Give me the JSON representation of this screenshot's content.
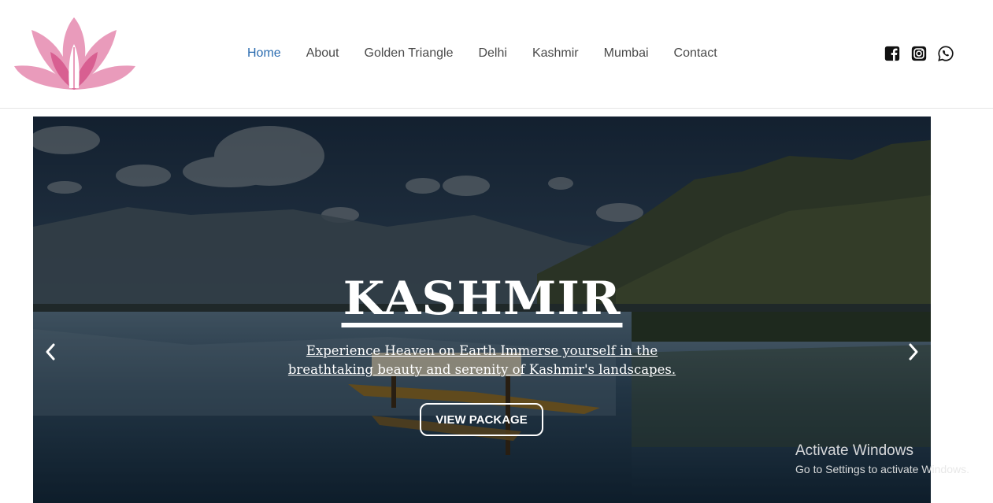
{
  "header": {
    "logo_icon": "lotus-namaste-logo",
    "nav": [
      {
        "label": "Home",
        "active": true
      },
      {
        "label": "About"
      },
      {
        "label": "Golden Triangle"
      },
      {
        "label": "Delhi"
      },
      {
        "label": "Kashmir"
      },
      {
        "label": "Mumbai"
      },
      {
        "label": "Contact"
      }
    ],
    "social": [
      "facebook-icon",
      "instagram-icon",
      "whatsapp-icon"
    ]
  },
  "hero": {
    "title": "KASHMIR",
    "subtitle": "Experience Heaven on Earth Immerse yourself in the breathtaking beauty and serenity of Kashmir's landscapes.",
    "button_label": "VIEW PACKAGE",
    "prev_icon": "chevron-left-icon",
    "next_icon": "chevron-right-icon"
  },
  "watermark": {
    "line1": "Activate Windows",
    "line2": "Go to Settings to activate Windows."
  },
  "colors": {
    "nav_active": "#2b6cb0",
    "nav_text": "#4a4a4a",
    "logo_pink": "#e06a9a"
  }
}
